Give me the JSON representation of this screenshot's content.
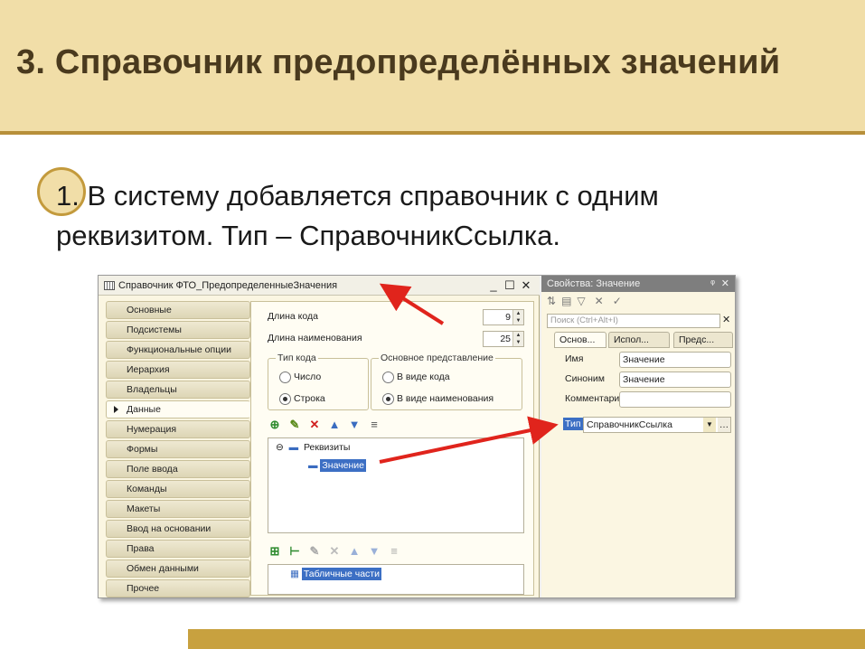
{
  "slide": {
    "title": "3. Справочник предопределённых значений",
    "bullet_text": "1. В систему добавляется справочник с одним реквизитом. Тип – СправочникСсылка."
  },
  "window": {
    "title": "Справочник ФТО_ПредопределенныеЗначения",
    "controls": [
      "_",
      "☐",
      "✕"
    ],
    "tabs": [
      "Основные",
      "Подсистемы",
      "Функциональные опции",
      "Иерархия",
      "Владельцы",
      "Данные",
      "Нумерация",
      "Формы",
      "Поле ввода",
      "Команды",
      "Макеты",
      "Ввод на основании",
      "Права",
      "Обмен данными",
      "Прочее"
    ],
    "active_tab": "Данные",
    "code_length_label": "Длина кода",
    "code_length_value": "9",
    "name_length_label": "Длина наименования",
    "name_length_value": "25",
    "code_type": {
      "title": "Тип кода",
      "options": [
        "Число",
        "Строка"
      ],
      "selected": "Строка"
    },
    "main_representation": {
      "title": "Основное представление",
      "options": [
        "В виде кода",
        "В виде наименования"
      ],
      "selected": "В виде наименования"
    },
    "attributes_tree": {
      "root": "Реквизиты",
      "child": "Значение"
    },
    "tabular_sections": "Табличные части"
  },
  "properties": {
    "title": "Свойства: Значение",
    "search_placeholder": "Поиск (Ctrl+Alt+I)",
    "tabs": [
      "Основ...",
      "Испол...",
      "Предс..."
    ],
    "name_label": "Имя",
    "name_value": "Значение",
    "synonym_label": "Синоним",
    "synonym_value": "Значение",
    "comment_label": "Комментарий",
    "comment_value": "",
    "type_label": "Тип",
    "type_value": "СправочникСсылка"
  },
  "colors": {
    "header_bg": "#f1dea8",
    "accent_gold": "#c8a13f",
    "arrow_red": "#e0241c"
  }
}
